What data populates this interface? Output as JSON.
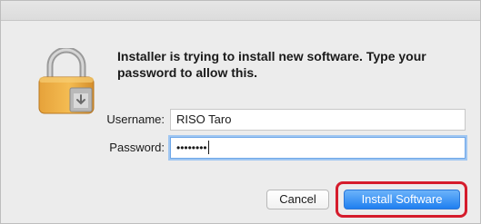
{
  "dialog": {
    "message": "Installer is trying to install new software. Type your password to allow this.",
    "icon": "lock-icon"
  },
  "username": {
    "label": "Username:",
    "value": "RISO Taro"
  },
  "password": {
    "label": "Password:",
    "masked_value": "••••••••"
  },
  "buttons": {
    "cancel_label": "Cancel",
    "install_label": "Install Software"
  },
  "colors": {
    "accent": "#1f7ff0",
    "highlight": "#d51c2c"
  }
}
